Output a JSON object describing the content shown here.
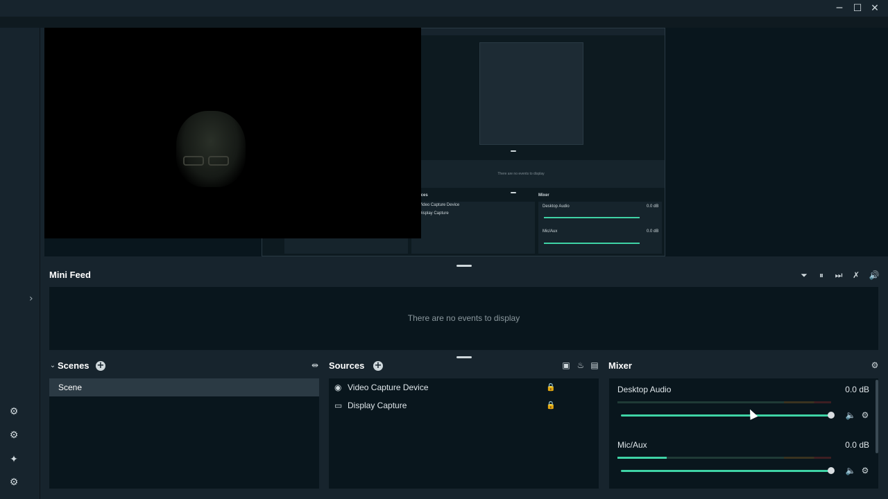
{
  "window": {
    "minimize_icon": "─",
    "maximize_icon": "☐",
    "close_icon": "✕"
  },
  "rail": {
    "icons": [
      "studio-mode-icon",
      "layout-editor-icon",
      "themes-icon",
      "settings-icon"
    ],
    "glyphs": [
      "⚙",
      "⚙",
      "✦",
      "⚙"
    ],
    "expand_glyph": "›"
  },
  "preview": {
    "nested_feed_text": "There are no events to display",
    "nested_sources_title": "Sources",
    "nested_mixer_title": "Mixer",
    "nested_sources": [
      "Video Capture Device",
      "Display Capture"
    ],
    "nested_mixer": [
      {
        "name": "Desktop Audio",
        "db": "0.0 dB"
      },
      {
        "name": "Mic/Aux",
        "db": "0.0 dB"
      }
    ]
  },
  "mini_feed": {
    "title": "Mini Feed",
    "empty_text": "There are no events to display",
    "controls": {
      "filter": "⏷",
      "pause": "⏸",
      "skip": "⏭",
      "mute": "✗",
      "volume": "🔊"
    }
  },
  "scenes": {
    "title": "Scenes",
    "add": "+",
    "collapse": "⌄",
    "transitions_icon": "⇹",
    "items": [
      "Scene"
    ]
  },
  "sources": {
    "title": "Sources",
    "add": "+",
    "items": [
      {
        "label": "Video Capture Device",
        "icon": "webcam-icon",
        "glyph": "◉"
      },
      {
        "label": "Display Capture",
        "icon": "monitor-icon",
        "glyph": "▭"
      }
    ],
    "lock_glyph": "🔒"
  },
  "mixer": {
    "title": "Mixer",
    "settings_glyph": "⚙",
    "channels": [
      {
        "name": "Desktop Audio",
        "db": "0.0 dB",
        "level": 0,
        "volume": 1.0
      },
      {
        "name": "Mic/Aux",
        "db": "0.0 dB",
        "level": 0.23,
        "volume": 1.0
      }
    ],
    "mute_glyph": "🔈",
    "gear_glyph": "⚙"
  },
  "colors": {
    "accent": "#3fd3a5",
    "background": "#17242d",
    "panel": "#09161d"
  }
}
